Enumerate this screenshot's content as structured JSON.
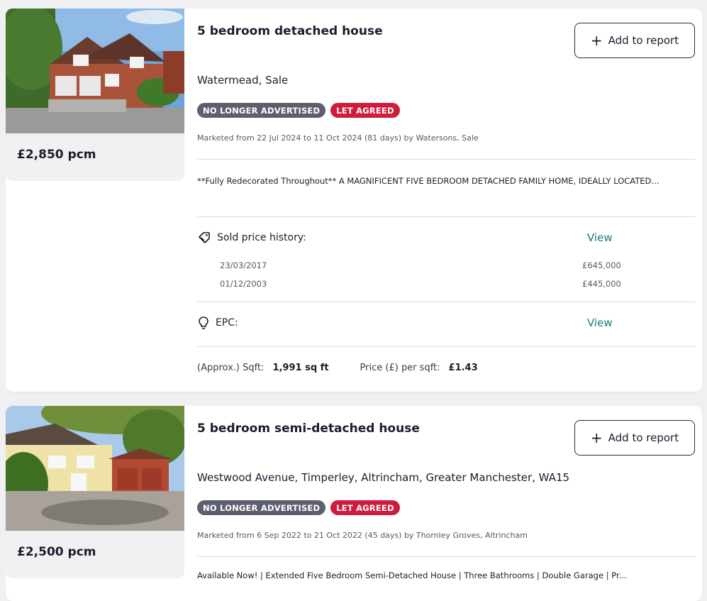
{
  "listings": [
    {
      "price": "£2,850 pcm",
      "title": "5 bedroom detached house",
      "add_button": "Add to report",
      "address": "Watermead, Sale",
      "badges": [
        "NO LONGER ADVERTISED",
        "LET AGREED"
      ],
      "marketed": "Marketed from 22 Jul 2024 to 11 Oct 2024 (81 days) by Watersons, Sale",
      "description": "**Fully Redecorated Throughout** A MAGNIFICENT FIVE BEDROOM DETACHED FAMILY HOME, IDEALLY LOCATED...",
      "sold_history_label": "Sold price history:",
      "sold_history_link": "View",
      "sold_history": [
        {
          "date": "23/03/2017",
          "price": "£645,000"
        },
        {
          "date": "01/12/2003",
          "price": "£445,000"
        }
      ],
      "epc_label": "EPC:",
      "epc_link": "View",
      "sqft_label": "(Approx.) Sqft:",
      "sqft_value": "1,991 sq ft",
      "ppsf_label": "Price (£) per sqft:",
      "ppsf_value": "£1.43"
    },
    {
      "price": "£2,500 pcm",
      "title": "5 bedroom semi-detached house",
      "add_button": "Add to report",
      "address": "Westwood Avenue, Timperley, Altrincham, Greater Manchester, WA15",
      "badges": [
        "NO LONGER ADVERTISED",
        "LET AGREED"
      ],
      "marketed": "Marketed from 6 Sep 2022 to 21 Oct 2022 (45 days) by Thornley Groves, Altrincham",
      "description": "Available Now! | Extended Five Bedroom Semi-Detached House | Three Bathrooms | Double Garage | Pr..."
    }
  ],
  "colors": {
    "badge_grey": "#5d5f6e",
    "badge_red": "#cf1b3c",
    "link_teal": "#1a7a6e"
  },
  "icons": [
    "plus-icon",
    "tag-icon",
    "lightbulb-icon"
  ]
}
